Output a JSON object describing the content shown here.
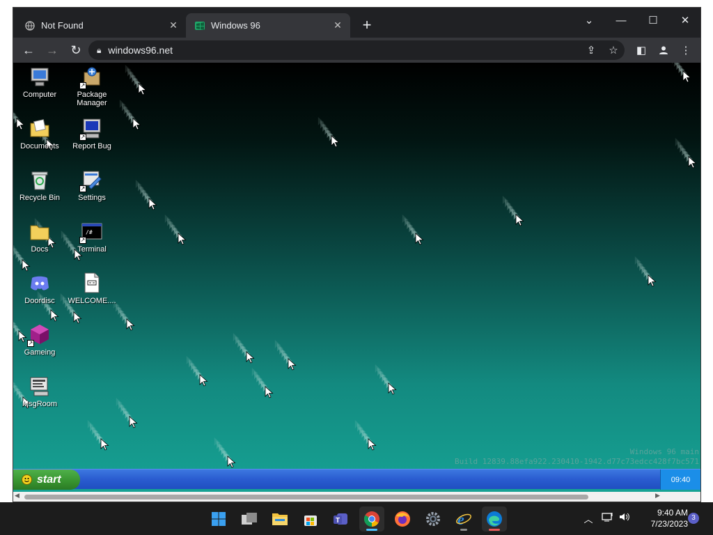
{
  "browser": {
    "tabs": [
      {
        "title": "Not Found",
        "favicon": "globe-icon",
        "active": false
      },
      {
        "title": "Windows 96",
        "favicon": "windows96-icon",
        "active": true
      }
    ],
    "url": "windows96.net"
  },
  "desktop": {
    "icons_col1": [
      {
        "label": "Computer",
        "icon": "computer-icon"
      },
      {
        "label": "Documents",
        "icon": "documents-icon"
      },
      {
        "label": "Recycle Bin",
        "icon": "recycle-bin-icon"
      },
      {
        "label": "Docs",
        "icon": "folder-icon"
      },
      {
        "label": "Doordisc",
        "icon": "doordisc-icon"
      },
      {
        "label": "Gameing",
        "icon": "gameing-icon"
      },
      {
        "label": "MsgRoom",
        "icon": "msgroom-icon"
      }
    ],
    "icons_col2": [
      {
        "label": "Package Manager",
        "icon": "package-manager-icon"
      },
      {
        "label": "Report Bug",
        "icon": "report-bug-icon"
      },
      {
        "label": "Settings",
        "icon": "settings-icon"
      },
      {
        "label": "Terminal",
        "icon": "terminal-icon"
      },
      {
        "label": "WELCOME....",
        "icon": "welcome-doc-icon"
      }
    ],
    "build_line1": "Windows 96 main",
    "build_line2": "Build 12839.88efa922.230410-1942.d77c73edcc428f7bc571",
    "start_label": "start",
    "taskbar_clock": "09:40"
  },
  "os_taskbar": {
    "time": "9:40 AM",
    "date": "7/23/2023",
    "notification_count": "3",
    "apps": [
      "start-icon",
      "task-view-icon",
      "file-explorer-icon",
      "store-icon",
      "teams-icon",
      "chrome-icon",
      "firefox-icon",
      "settings-icon",
      "internet-explorer-icon",
      "edge-icon"
    ]
  },
  "colors": {
    "desktop_top": "#000000",
    "desktop_bottom": "#16a294",
    "win96_taskbar": "#2a5cd0",
    "start_button": "#37932f"
  }
}
